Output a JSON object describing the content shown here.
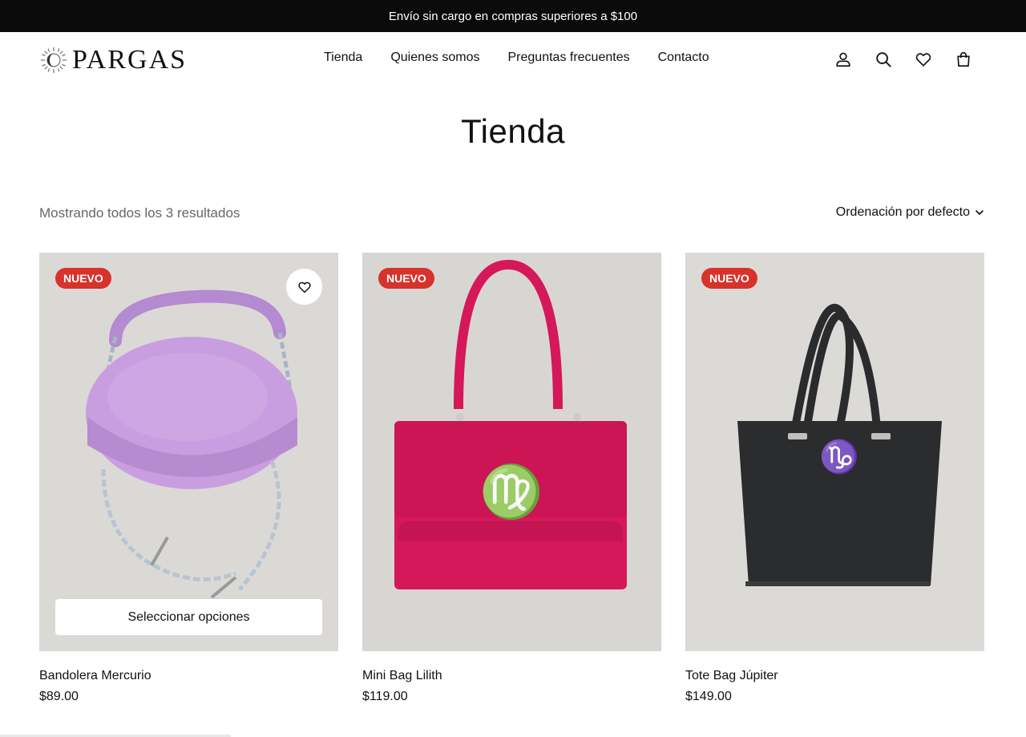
{
  "announcement": "Envío sin cargo en compras superiores a $100",
  "brand": {
    "name": "PARGAS"
  },
  "nav": [
    "Tienda",
    "Quienes somos",
    "Preguntas frecuentes",
    "Contacto"
  ],
  "header_icons": [
    "user-icon",
    "search-icon",
    "heart-icon",
    "shopping-bag-icon"
  ],
  "page": {
    "title": "Tienda",
    "results_text": "Mostrando todos los 3 resultados",
    "sort_label": "Ordenación por defecto"
  },
  "products": [
    {
      "badge": "NUEVO",
      "name": "Bandolera Mercurio",
      "price": "$89.00",
      "action": "Seleccionar opciones",
      "color": "#c99ee0"
    },
    {
      "badge": "NUEVO",
      "name": "Mini Bag Lilith",
      "price": "$119.00",
      "color": "#d4185a"
    },
    {
      "badge": "NUEVO",
      "name": "Tote Bag Júpiter",
      "price": "$149.00",
      "color": "#2b2c2e"
    }
  ],
  "colors": {
    "topbar": "#0b0b0b",
    "badge": "#d7322c",
    "card_bg": "#d9d7d4"
  }
}
